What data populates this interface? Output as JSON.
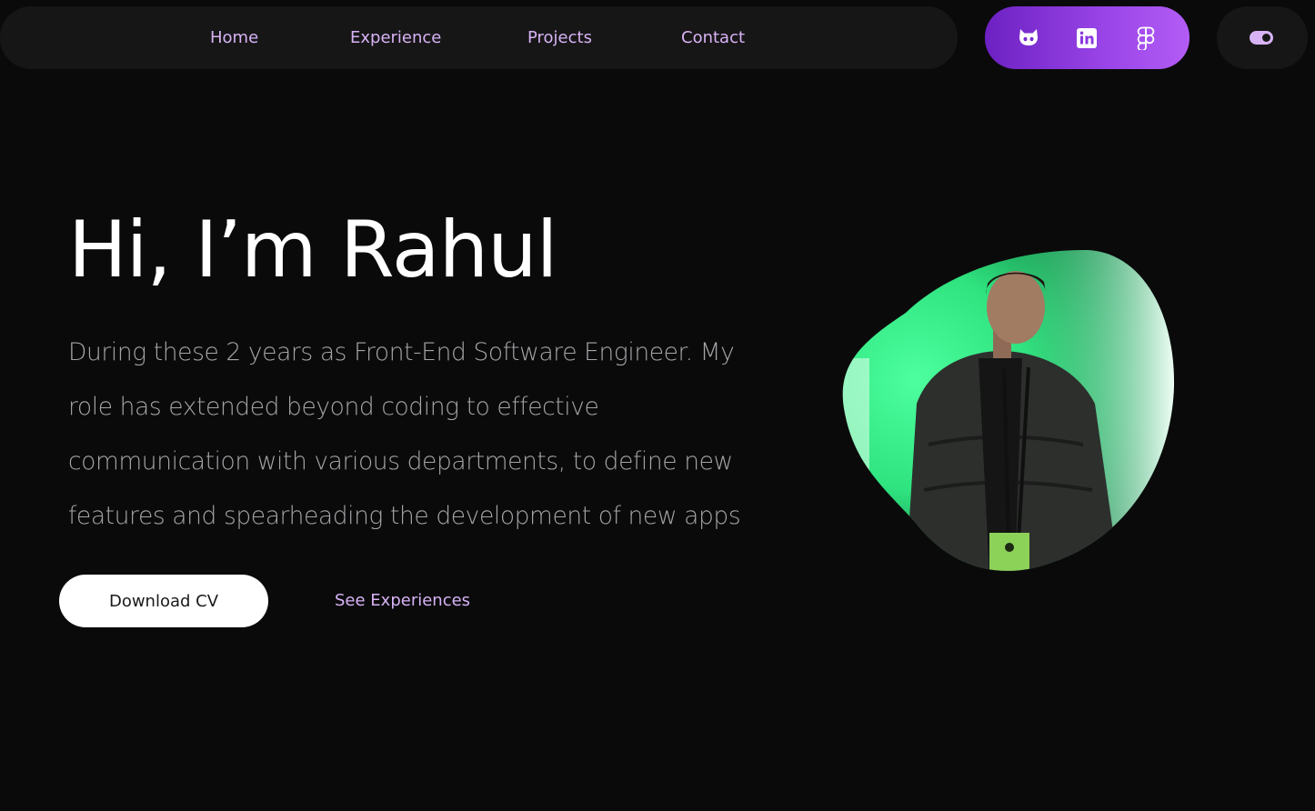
{
  "nav": {
    "links": [
      "Home",
      "Experience",
      "Projects",
      "Contact"
    ]
  },
  "socials": {
    "icons": [
      "github-icon",
      "linkedin-icon",
      "figma-icon"
    ]
  },
  "theme": {
    "icon": "toggle-icon"
  },
  "hero": {
    "title": "Hi, I’m Rahul",
    "description": "During these 2 years as Front-End Software Engineer. My role has extended beyond coding to effective communication with various departments, to define new features and spearheading the development of new apps",
    "primary_button": "Download CV",
    "secondary_link": "See Experiences"
  },
  "colors": {
    "background": "#0b0a0b",
    "nav_background": "#171617",
    "accent_text": "#d7b3f5",
    "gradient_start": "#6d21c2",
    "gradient_end": "#b35cf5",
    "body_text": "#a5a4a7"
  }
}
